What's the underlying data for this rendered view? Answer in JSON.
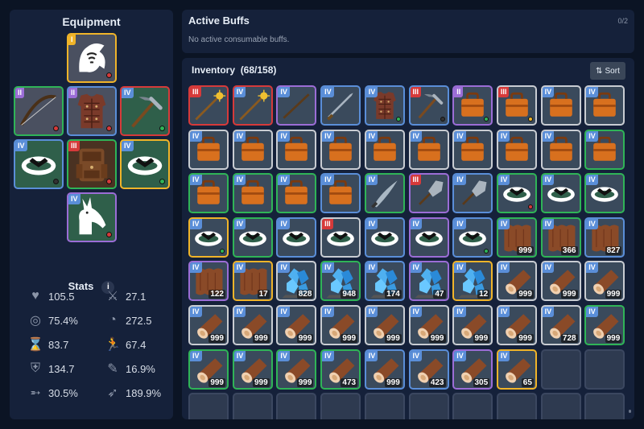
{
  "colors": {
    "bg": "#0b1424",
    "panel": "#15213a",
    "tier_I": "#f0b429",
    "tier_II": "#9b6dd6",
    "tier_III": "#d63a3a",
    "tier_IV": "#5a8ed8",
    "quality_green": "#2fb457",
    "quality_white": "#c8ccd2",
    "quality_purple": "#9b6dd6",
    "quality_orange": "#f0b429",
    "quality_red": "#d63a3a",
    "quality_blue": "#5a8ed8"
  },
  "equipment": {
    "title": "Equipment",
    "slots": [
      {
        "id": "head",
        "tier": "I",
        "item": "hood-icon",
        "quality": "orange",
        "dot": "#d63a3a",
        "bg": "grey"
      },
      {
        "id": "offhand",
        "tier": "II",
        "item": "bow-icon",
        "quality": "green",
        "dot": "#d63a3a",
        "bg": "grey"
      },
      {
        "id": "chest",
        "tier": "II",
        "item": "leather-armor-icon",
        "quality": "blue",
        "dot": "#d63a3a",
        "bg": "grey"
      },
      {
        "id": "tool",
        "tier": "IV",
        "item": "pickaxe-icon",
        "quality": "red",
        "dot": "#2fb457",
        "bg": "teal"
      },
      {
        "id": "ring-left",
        "tier": "IV",
        "item": "belt-ring-icon",
        "quality": "blue",
        "dot": "#333333",
        "bg": "teal"
      },
      {
        "id": "backpack",
        "tier": "III",
        "item": "backpack-icon",
        "quality": "green",
        "dot": "#d63a3a",
        "bg": "brown"
      },
      {
        "id": "ring-right",
        "tier": "IV",
        "item": "belt-ring-icon",
        "quality": "orange",
        "dot": "#2fb457",
        "bg": "teal"
      },
      {
        "id": "mount",
        "tier": "IV",
        "item": "donkey-icon",
        "quality": "purple",
        "dot": "#d63a3a",
        "bg": "teal"
      }
    ]
  },
  "stats": {
    "title": "Stats",
    "info_icon": "info-icon",
    "items": [
      {
        "icon": "heart-icon",
        "value": "105.5"
      },
      {
        "icon": "sword-icon",
        "value": "27.1"
      },
      {
        "icon": "target-icon",
        "value": "75.4%"
      },
      {
        "icon": "radar-icon",
        "value": "272.5"
      },
      {
        "icon": "hourglass-icon",
        "value": "83.7"
      },
      {
        "icon": "running-icon",
        "value": "67.4"
      },
      {
        "icon": "shield-icon",
        "value": "134.7"
      },
      {
        "icon": "feather-icon",
        "value": "16.9%"
      },
      {
        "icon": "arrow-icon",
        "value": "30.5%"
      },
      {
        "icon": "double-arrow-icon",
        "value": "189.9%"
      }
    ]
  },
  "buffs": {
    "title": "Active Buffs",
    "count": "0/2",
    "empty_text": "No active consumable buffs."
  },
  "inventory": {
    "title": "Inventory",
    "count": "(68/158)",
    "sort_label": "Sort",
    "items": [
      {
        "tier": "III",
        "item": "staff",
        "quality": "red",
        "bg": "grey"
      },
      {
        "tier": "IV",
        "item": "staff",
        "quality": "red",
        "bg": "teal"
      },
      {
        "tier": "IV",
        "item": "stick",
        "quality": "purple",
        "bg": "teal"
      },
      {
        "tier": "IV",
        "item": "sword",
        "quality": "blue",
        "bg": "teal"
      },
      {
        "tier": "IV",
        "item": "armor",
        "quality": "blue",
        "bg": "teal",
        "dot": "#2fb457"
      },
      {
        "tier": "III",
        "item": "pickaxe",
        "quality": "blue",
        "bg": "teal",
        "dot": "#333333"
      },
      {
        "tier": "II",
        "item": "bag",
        "quality": "purple",
        "bg": "grey",
        "dot": "#2fb457"
      },
      {
        "tier": "III",
        "item": "bag",
        "quality": "white",
        "bg": "brown",
        "dot": "#f0b429"
      },
      {
        "tier": "IV",
        "item": "bag",
        "quality": "white",
        "bg": "teal"
      },
      {
        "tier": "IV",
        "item": "bag",
        "quality": "white",
        "bg": "teal"
      },
      {
        "tier": "IV",
        "item": "bag",
        "quality": "white",
        "bg": "teal"
      },
      {
        "tier": "IV",
        "item": "bag",
        "quality": "white",
        "bg": "teal"
      },
      {
        "tier": "IV",
        "item": "bag",
        "quality": "white",
        "bg": "teal"
      },
      {
        "tier": "IV",
        "item": "bag",
        "quality": "white",
        "bg": "teal"
      },
      {
        "tier": "IV",
        "item": "bag",
        "quality": "white",
        "bg": "teal"
      },
      {
        "tier": "IV",
        "item": "bag",
        "quality": "white",
        "bg": "teal"
      },
      {
        "tier": "IV",
        "item": "bag",
        "quality": "white",
        "bg": "teal"
      },
      {
        "tier": "IV",
        "item": "bag",
        "quality": "white",
        "bg": "teal"
      },
      {
        "tier": "IV",
        "item": "bag",
        "quality": "white",
        "bg": "teal"
      },
      {
        "tier": "IV",
        "item": "bag",
        "quality": "green",
        "bg": "teal"
      },
      {
        "tier": "IV",
        "item": "bag",
        "quality": "green",
        "bg": "teal"
      },
      {
        "tier": "IV",
        "item": "bag",
        "quality": "green",
        "bg": "teal"
      },
      {
        "tier": "IV",
        "item": "bag",
        "quality": "green",
        "bg": "teal"
      },
      {
        "tier": "IV",
        "item": "bag",
        "quality": "blue",
        "bg": "teal"
      },
      {
        "tier": "IV",
        "item": "blade",
        "quality": "green",
        "bg": "teal"
      },
      {
        "tier": "III",
        "item": "shovel",
        "quality": "purple",
        "bg": "teal"
      },
      {
        "tier": "IV",
        "item": "shovel",
        "quality": "blue",
        "bg": "teal"
      },
      {
        "tier": "IV",
        "item": "belt",
        "quality": "green",
        "bg": "teal",
        "dot": "#d63a3a"
      },
      {
        "tier": "IV",
        "item": "belt",
        "quality": "green",
        "bg": "teal"
      },
      {
        "tier": "IV",
        "item": "belt",
        "quality": "green",
        "bg": "teal"
      },
      {
        "tier": "IV",
        "item": "belt",
        "quality": "orange",
        "bg": "teal",
        "dot": "#2fb457"
      },
      {
        "tier": "IV",
        "item": "belt",
        "quality": "green",
        "bg": "teal"
      },
      {
        "tier": "IV",
        "item": "belt",
        "quality": "blue",
        "bg": "teal"
      },
      {
        "tier": "III",
        "item": "belt",
        "quality": "white",
        "bg": "brown"
      },
      {
        "tier": "IV",
        "item": "belt",
        "quality": "blue",
        "bg": "teal"
      },
      {
        "tier": "IV",
        "item": "belt",
        "quality": "purple",
        "bg": "teal"
      },
      {
        "tier": "IV",
        "item": "belt",
        "quality": "blue",
        "bg": "teal",
        "dot": "#2fb457"
      },
      {
        "tier": "IV",
        "item": "hide",
        "quality": "green",
        "bg": "teal",
        "qty": "999"
      },
      {
        "tier": "IV",
        "item": "hide",
        "quality": "green",
        "bg": "teal",
        "qty": "366"
      },
      {
        "tier": "IV",
        "item": "hide",
        "quality": "blue",
        "bg": "teal",
        "qty": "827"
      },
      {
        "tier": "IV",
        "item": "hide",
        "quality": "purple",
        "bg": "teal",
        "qty": "122"
      },
      {
        "tier": "IV",
        "item": "hide",
        "quality": "orange",
        "bg": "teal",
        "qty": "17"
      },
      {
        "tier": "IV",
        "item": "crystal",
        "quality": "white",
        "bg": "teal",
        "qty": "828"
      },
      {
        "tier": "IV",
        "item": "crystal",
        "quality": "green",
        "bg": "teal",
        "qty": "948"
      },
      {
        "tier": "IV",
        "item": "crystal",
        "quality": "blue",
        "bg": "teal",
        "qty": "174"
      },
      {
        "tier": "IV",
        "item": "crystal",
        "quality": "purple",
        "bg": "teal",
        "qty": "47"
      },
      {
        "tier": "IV",
        "item": "crystal",
        "quality": "orange",
        "bg": "teal",
        "qty": "12"
      },
      {
        "tier": "IV",
        "item": "log",
        "quality": "white",
        "bg": "teal",
        "qty": "999"
      },
      {
        "tier": "IV",
        "item": "log",
        "quality": "white",
        "bg": "teal",
        "qty": "999"
      },
      {
        "tier": "IV",
        "item": "log",
        "quality": "white",
        "bg": "teal",
        "qty": "999"
      },
      {
        "tier": "IV",
        "item": "log",
        "quality": "white",
        "bg": "teal",
        "qty": "999"
      },
      {
        "tier": "IV",
        "item": "log",
        "quality": "white",
        "bg": "teal",
        "qty": "999"
      },
      {
        "tier": "IV",
        "item": "log",
        "quality": "white",
        "bg": "teal",
        "qty": "999"
      },
      {
        "tier": "IV",
        "item": "log",
        "quality": "white",
        "bg": "teal",
        "qty": "999"
      },
      {
        "tier": "IV",
        "item": "log",
        "quality": "white",
        "bg": "teal",
        "qty": "999"
      },
      {
        "tier": "IV",
        "item": "log",
        "quality": "white",
        "bg": "teal",
        "qty": "999"
      },
      {
        "tier": "IV",
        "item": "log",
        "quality": "white",
        "bg": "teal",
        "qty": "999"
      },
      {
        "tier": "IV",
        "item": "log",
        "quality": "white",
        "bg": "teal",
        "qty": "999"
      },
      {
        "tier": "IV",
        "item": "log",
        "quality": "white",
        "bg": "teal",
        "qty": "728"
      },
      {
        "tier": "IV",
        "item": "log",
        "quality": "green",
        "bg": "teal",
        "qty": "999"
      },
      {
        "tier": "IV",
        "item": "log",
        "quality": "green",
        "bg": "teal",
        "qty": "999"
      },
      {
        "tier": "IV",
        "item": "log",
        "quality": "green",
        "bg": "teal",
        "qty": "999"
      },
      {
        "tier": "IV",
        "item": "log",
        "quality": "green",
        "bg": "teal",
        "qty": "999"
      },
      {
        "tier": "IV",
        "item": "log",
        "quality": "green",
        "bg": "teal",
        "qty": "473"
      },
      {
        "tier": "IV",
        "item": "log",
        "quality": "blue",
        "bg": "teal",
        "qty": "999"
      },
      {
        "tier": "IV",
        "item": "log",
        "quality": "blue",
        "bg": "teal",
        "qty": "423"
      },
      {
        "tier": "IV",
        "item": "log",
        "quality": "purple",
        "bg": "teal",
        "qty": "305"
      },
      {
        "tier": "IV",
        "item": "log",
        "quality": "orange",
        "bg": "teal",
        "qty": "65"
      }
    ],
    "empty_slots": 12
  }
}
